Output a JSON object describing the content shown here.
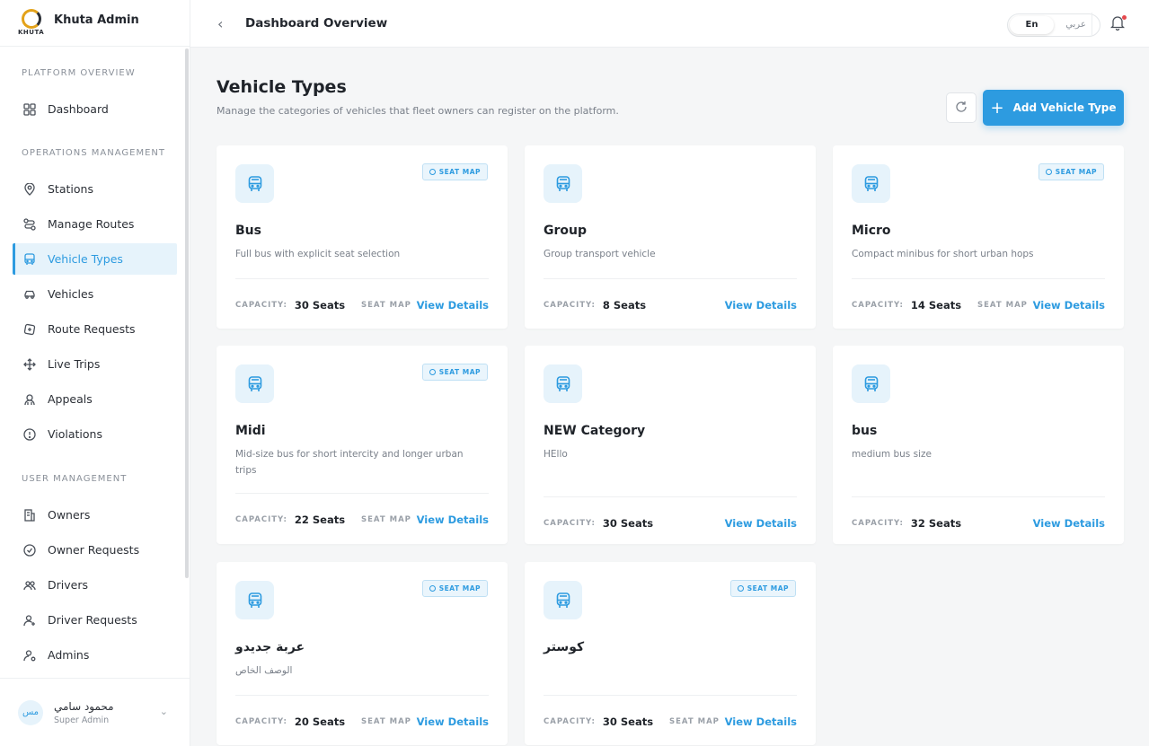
{
  "brand": {
    "name": "Khuta Admin",
    "logo_text": "KHUTA"
  },
  "sidebar": {
    "sections": [
      {
        "title": "PLATFORM OVERVIEW",
        "items": [
          {
            "label": "Dashboard",
            "icon": "grid-icon"
          }
        ]
      },
      {
        "title": "OPERATIONS MANAGEMENT",
        "items": [
          {
            "label": "Stations",
            "icon": "map-pin-icon"
          },
          {
            "label": "Manage Routes",
            "icon": "route-icon"
          },
          {
            "label": "Vehicle Types",
            "icon": "bus-icon"
          },
          {
            "label": "Vehicles",
            "icon": "car-icon"
          },
          {
            "label": "Route Requests",
            "icon": "route-request-icon"
          },
          {
            "label": "Live Trips",
            "icon": "move-icon"
          },
          {
            "label": "Appeals",
            "icon": "appeal-icon"
          },
          {
            "label": "Violations",
            "icon": "alert-circle-icon"
          }
        ]
      },
      {
        "title": "USER MANAGEMENT",
        "items": [
          {
            "label": "Owners",
            "icon": "building-icon"
          },
          {
            "label": "Owner Requests",
            "icon": "check-circle-icon"
          },
          {
            "label": "Drivers",
            "icon": "users-icon"
          },
          {
            "label": "Driver Requests",
            "icon": "user-plus-icon"
          },
          {
            "label": "Admins",
            "icon": "user-gear-icon"
          }
        ]
      }
    ],
    "active": "Vehicle Types",
    "user": {
      "initials": "مس",
      "name": "محمود سامي",
      "role": "Super Admin"
    }
  },
  "header": {
    "title": "Dashboard Overview",
    "lang_en": "En",
    "lang_ar": "عربي"
  },
  "content": {
    "title": "Vehicle Types",
    "subtitle": "Manage the categories of vehicles that fleet owners can register on the platform.",
    "add_label": "Add Vehicle Type",
    "capacity_label": "CAPACITY:",
    "seat_map_badge": "SEAT MAP",
    "seat_map_tag": "SEAT MAP",
    "details_label": "View Details"
  },
  "cards": [
    {
      "name": "Bus",
      "desc": "Full bus with explicit seat selection",
      "capacity": "30 Seats",
      "seat_map": true
    },
    {
      "name": "Group",
      "desc": "Group transport vehicle",
      "capacity": "8 Seats",
      "seat_map": false
    },
    {
      "name": "Micro",
      "desc": "Compact minibus for short urban hops",
      "capacity": "14 Seats",
      "seat_map": true
    },
    {
      "name": "Midi",
      "desc": "Mid-size bus for short intercity and longer urban trips",
      "capacity": "22 Seats",
      "seat_map": true
    },
    {
      "name": "NEW Category",
      "desc": "HEllo",
      "capacity": "30 Seats",
      "seat_map": false
    },
    {
      "name": "bus",
      "desc": "medium bus size",
      "capacity": "32 Seats",
      "seat_map": false
    },
    {
      "name": "عربة جديدو",
      "desc": "الوصف الخاص",
      "capacity": "20 Seats",
      "seat_map": true
    },
    {
      "name": "كوستر",
      "desc": "",
      "capacity": "30 Seats",
      "seat_map": true
    }
  ],
  "colors": {
    "accent": "#2d9be0",
    "active_bg": "#e6f3fb",
    "notification": "#e5484d"
  }
}
